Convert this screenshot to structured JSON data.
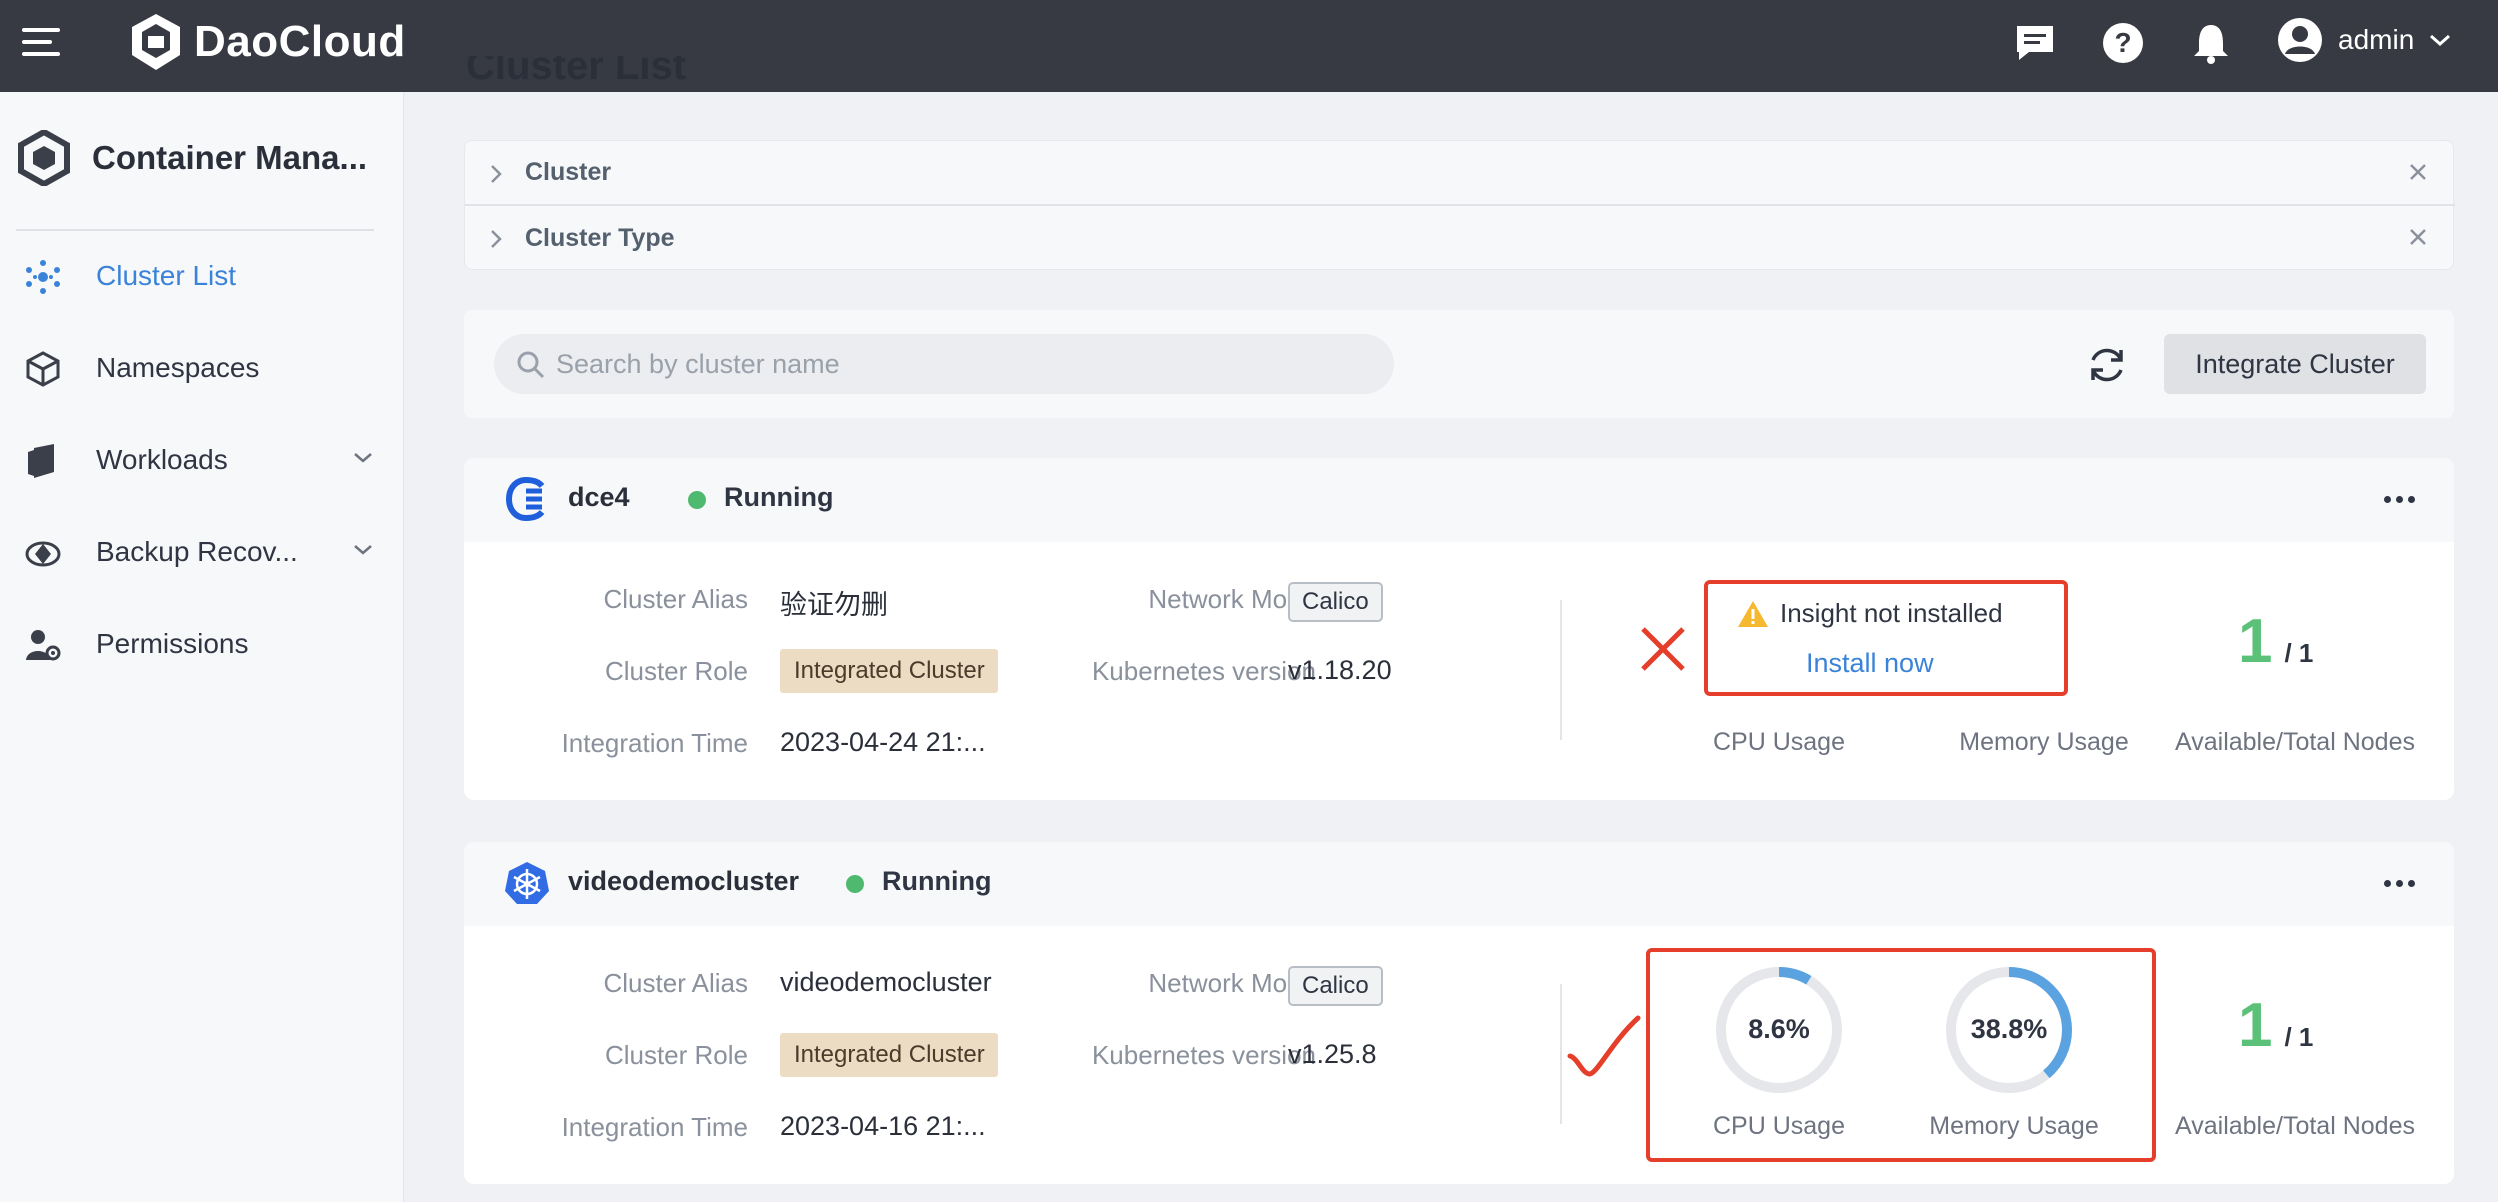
{
  "app": {
    "brand": "DaoCloud",
    "user": "admin"
  },
  "sidebar": {
    "title": "Container Mana...",
    "items": [
      {
        "label": "Cluster List",
        "icon": "cluster-icon",
        "active": true
      },
      {
        "label": "Namespaces",
        "icon": "namespace-icon"
      },
      {
        "label": "Workloads",
        "icon": "workload-icon",
        "expandable": true
      },
      {
        "label": "Backup Recov...",
        "icon": "backup-icon",
        "expandable": true
      },
      {
        "label": "Permissions",
        "icon": "permissions-icon"
      }
    ]
  },
  "page": {
    "title": "Cluster List"
  },
  "filters": [
    {
      "label": "Cluster"
    },
    {
      "label": "Cluster Type"
    }
  ],
  "toolbar": {
    "search_placeholder": "Search by cluster name",
    "integrate_label": "Integrate Cluster"
  },
  "labels": {
    "alias": "Cluster Alias",
    "role": "Cluster Role",
    "integration_time": "Integration Time",
    "network_mode": "Network Mode",
    "k8s_version": "Kubernetes version",
    "cpu_usage": "CPU Usage",
    "memory_usage": "Memory Usage",
    "nodes": "Available/Total Nodes"
  },
  "clusters": [
    {
      "name": "dce4",
      "status": "Running",
      "alias": "验证勿删",
      "role": "Integrated Cluster",
      "integration_time": "2023-04-24 21:...",
      "network_mode": "Calico",
      "k8s_version": "v1.18.20",
      "insight_warning": "Insight not installed",
      "install_link": "Install now",
      "nodes_available": "1",
      "nodes_total": "/ 1"
    },
    {
      "name": "videodemocluster",
      "status": "Running",
      "alias": "videodemocluster",
      "role": "Integrated Cluster",
      "integration_time": "2023-04-16 21:...",
      "network_mode": "Calico",
      "k8s_version": "v1.25.8",
      "cpu_usage": "8.6%",
      "cpu_usage_fraction": 0.086,
      "memory_usage": "38.8%",
      "memory_usage_fraction": 0.388,
      "nodes_available": "1",
      "nodes_total": "/ 1"
    }
  ],
  "colors": {
    "topbar": "#373a42",
    "accent": "#3a83d8",
    "running": "#4fba6f",
    "nodes": "#5cc178",
    "annotation": "#e53e2a"
  }
}
